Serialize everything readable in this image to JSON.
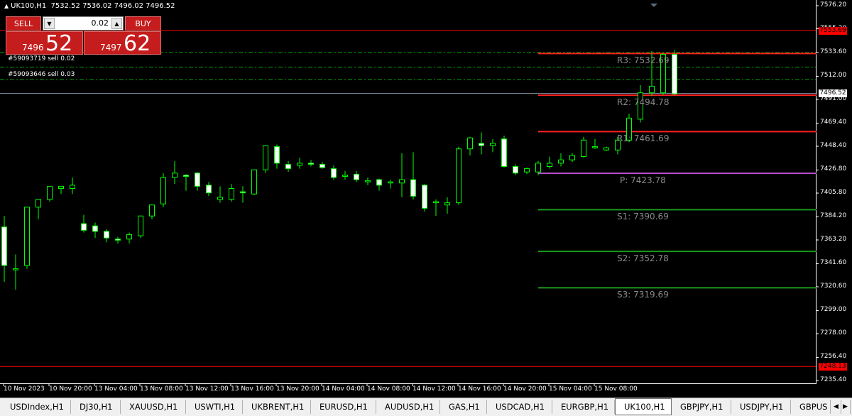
{
  "header": {
    "symbol": "UK100,H1",
    "ohlc": "7532.52 7536.02 7496.02 7496.52"
  },
  "trade_panel": {
    "sell_label": "SELL",
    "buy_label": "BUY",
    "lot": "0.02",
    "sell_price_small": "7496",
    "sell_price_big": "52",
    "buy_price_small": "7497",
    "buy_price_big": "62"
  },
  "orders": [
    {
      "label": "#59093719 sell 0.02"
    },
    {
      "label": "#59093646 sell 0.03"
    }
  ],
  "pivots": [
    {
      "label": "R3: 7532.69",
      "value": 7532.69,
      "color": "#ff2020"
    },
    {
      "label": "R2: 7494.78",
      "value": 7494.78,
      "color": "#ff2020"
    },
    {
      "label": "R1: 7461.69",
      "value": 7461.69,
      "color": "#ff2020"
    },
    {
      "label": "P: 7423.78",
      "value": 7423.78,
      "color": "#b84fd0"
    },
    {
      "label": "S1: 7390.69",
      "value": 7390.69,
      "color": "#1a9a1a"
    },
    {
      "label": "S2: 7352.78",
      "value": 7352.78,
      "color": "#1a9a1a"
    },
    {
      "label": "S3: 7319.69",
      "value": 7319.69,
      "color": "#1a9a1a"
    }
  ],
  "price_tags": [
    {
      "label": "7553.69",
      "value": 7553.69,
      "bg": "#ff0000",
      "fg": "#000000"
    },
    {
      "label": "7496.52",
      "value": 7496.52,
      "bg": "#ffffff",
      "fg": "#000000"
    },
    {
      "label": "7248.13",
      "value": 7248.13,
      "bg": "#ff0000",
      "fg": "#000000"
    }
  ],
  "colors": {
    "background": "#000000",
    "bull_body": "#000000",
    "bear_body": "#ffffff",
    "wick": "#00ff00",
    "order_line": "#00aa00",
    "bid_line": "#778899"
  },
  "chart_data": {
    "type": "candlestick",
    "symbol": "UK100",
    "timeframe": "H1",
    "ylim": [
      7235.4,
      7576.2
    ],
    "y_ticks": [
      "7576.20",
      "7555.20",
      "7533.60",
      "7512.00",
      "7491.00",
      "7469.40",
      "7448.40",
      "7426.80",
      "7405.80",
      "7384.20",
      "7363.20",
      "7341.60",
      "7320.60",
      "7299.00",
      "7278.00",
      "7256.40",
      "7235.40"
    ],
    "x_ticks": [
      "10 Nov 2023",
      "10 Nov 20:00",
      "13 Nov 04:00",
      "13 Nov 08:00",
      "13 Nov 12:00",
      "13 Nov 16:00",
      "13 Nov 20:00",
      "14 Nov 04:00",
      "14 Nov 08:00",
      "14 Nov 12:00",
      "14 Nov 16:00",
      "14 Nov 20:00",
      "15 Nov 04:00",
      "15 Nov 08:00"
    ],
    "order_levels": [
      7533.6,
      7520.3,
      7509.0
    ],
    "candles": [
      {
        "o": 7375,
        "h": 7385,
        "c": 7340,
        "l": 7325
      },
      {
        "o": 7336,
        "h": 7350,
        "c": 7337,
        "l": 7318
      },
      {
        "o": 7340,
        "h": 7390,
        "c": 7393,
        "l": 7337
      },
      {
        "o": 7393,
        "h": 7400,
        "c": 7400,
        "l": 7382
      },
      {
        "o": 7400,
        "h": 7410,
        "c": 7412,
        "l": 7398
      },
      {
        "o": 7410,
        "h": 7412,
        "c": 7412,
        "l": 7405
      },
      {
        "o": 7410,
        "h": 7420,
        "c": 7413,
        "l": 7405
      },
      {
        "o": 7378,
        "h": 7386,
        "c": 7372,
        "l": 7370
      },
      {
        "o": 7376,
        "h": 7379,
        "c": 7371,
        "l": 7365
      },
      {
        "o": 7371,
        "h": 7373,
        "c": 7365,
        "l": 7361
      },
      {
        "o": 7364,
        "h": 7366,
        "c": 7363,
        "l": 7360
      },
      {
        "o": 7364,
        "h": 7370,
        "c": 7368,
        "l": 7360
      },
      {
        "o": 7367,
        "h": 7385,
        "c": 7385,
        "l": 7365
      },
      {
        "o": 7385,
        "h": 7395,
        "c": 7395,
        "l": 7382
      },
      {
        "o": 7396,
        "h": 7424,
        "c": 7420,
        "l": 7393
      },
      {
        "o": 7420,
        "h": 7435,
        "c": 7424,
        "l": 7414
      },
      {
        "o": 7422,
        "h": 7423,
        "c": 7421,
        "l": 7408
      },
      {
        "o": 7424,
        "h": 7425,
        "c": 7412,
        "l": 7408
      },
      {
        "o": 7413,
        "h": 7416,
        "c": 7406,
        "l": 7403
      },
      {
        "o": 7400,
        "h": 7412,
        "c": 7402,
        "l": 7397
      },
      {
        "o": 7400,
        "h": 7414,
        "c": 7410,
        "l": 7398
      },
      {
        "o": 7407,
        "h": 7412,
        "c": 7406,
        "l": 7397
      },
      {
        "o": 7405,
        "h": 7426,
        "c": 7427,
        "l": 7404
      },
      {
        "o": 7427,
        "h": 7449,
        "c": 7449,
        "l": 7424
      },
      {
        "o": 7448,
        "h": 7450,
        "c": 7433,
        "l": 7428
      },
      {
        "o": 7432,
        "h": 7435,
        "c": 7428,
        "l": 7425
      },
      {
        "o": 7431,
        "h": 7438,
        "c": 7433,
        "l": 7428
      },
      {
        "o": 7433,
        "h": 7436,
        "c": 7432,
        "l": 7430
      },
      {
        "o": 7432,
        "h": 7434,
        "c": 7429,
        "l": 7428
      },
      {
        "o": 7428,
        "h": 7431,
        "c": 7420,
        "l": 7418
      },
      {
        "o": 7421,
        "h": 7426,
        "c": 7422,
        "l": 7418
      },
      {
        "o": 7423,
        "h": 7426,
        "c": 7418,
        "l": 7416
      },
      {
        "o": 7416,
        "h": 7420,
        "c": 7417,
        "l": 7413
      },
      {
        "o": 7418,
        "h": 7419,
        "c": 7413,
        "l": 7408
      },
      {
        "o": 7415,
        "h": 7418,
        "c": 7416,
        "l": 7410
      },
      {
        "o": 7415,
        "h": 7442,
        "c": 7418,
        "l": 7402
      },
      {
        "o": 7418,
        "h": 7443,
        "c": 7403,
        "l": 7400
      },
      {
        "o": 7413,
        "h": 7414,
        "c": 7392,
        "l": 7389
      },
      {
        "o": 7397,
        "h": 7400,
        "c": 7398,
        "l": 7385
      },
      {
        "o": 7395,
        "h": 7402,
        "c": 7397,
        "l": 7387
      },
      {
        "o": 7397,
        "h": 7448,
        "c": 7446,
        "l": 7395
      },
      {
        "o": 7446,
        "h": 7457,
        "c": 7456,
        "l": 7440
      },
      {
        "o": 7451,
        "h": 7461,
        "c": 7449,
        "l": 7441
      },
      {
        "o": 7449,
        "h": 7455,
        "c": 7451,
        "l": 7443
      },
      {
        "o": 7455,
        "h": 7458,
        "c": 7430,
        "l": 7429
      },
      {
        "o": 7430,
        "h": 7432,
        "c": 7424,
        "l": 7422
      },
      {
        "o": 7425,
        "h": 7429,
        "c": 7428,
        "l": 7423
      },
      {
        "o": 7425,
        "h": 7435,
        "c": 7433,
        "l": 7422
      },
      {
        "o": 7430,
        "h": 7439,
        "c": 7433,
        "l": 7428
      },
      {
        "o": 7433,
        "h": 7442,
        "c": 7436,
        "l": 7430
      },
      {
        "o": 7436,
        "h": 7442,
        "c": 7440,
        "l": 7434
      },
      {
        "o": 7439,
        "h": 7457,
        "c": 7454,
        "l": 7438
      },
      {
        "o": 7447,
        "h": 7455,
        "c": 7448,
        "l": 7446
      },
      {
        "o": 7445,
        "h": 7448,
        "c": 7447,
        "l": 7444
      },
      {
        "o": 7445,
        "h": 7457,
        "c": 7454,
        "l": 7441
      },
      {
        "o": 7454,
        "h": 7478,
        "c": 7474,
        "l": 7452
      },
      {
        "o": 7473,
        "h": 7504,
        "c": 7497,
        "l": 7470
      },
      {
        "o": 7497,
        "h": 7535,
        "c": 7503,
        "l": 7494
      },
      {
        "o": 7497,
        "h": 7533,
        "c": 7532,
        "l": 7495
      },
      {
        "o": 7532,
        "h": 7536,
        "c": 7496,
        "l": 7495
      }
    ]
  },
  "tabs": [
    {
      "label": "USDIndex,H1",
      "active": false
    },
    {
      "label": "DJ30,H1",
      "active": false
    },
    {
      "label": "XAUUSD,H1",
      "active": false
    },
    {
      "label": "USWTI,H1",
      "active": false
    },
    {
      "label": "UKBRENT,H1",
      "active": false
    },
    {
      "label": "EURUSD,H1",
      "active": false
    },
    {
      "label": "AUDUSD,H1",
      "active": false
    },
    {
      "label": "GAS,H1",
      "active": false
    },
    {
      "label": "USDCAD,H1",
      "active": false
    },
    {
      "label": "EURGBP,H1",
      "active": false
    },
    {
      "label": "UK100,H1",
      "active": true
    },
    {
      "label": "GBPJPY,H1",
      "active": false
    },
    {
      "label": "USDJPY,H1",
      "active": false
    },
    {
      "label": "GBPUS",
      "active": false
    }
  ]
}
